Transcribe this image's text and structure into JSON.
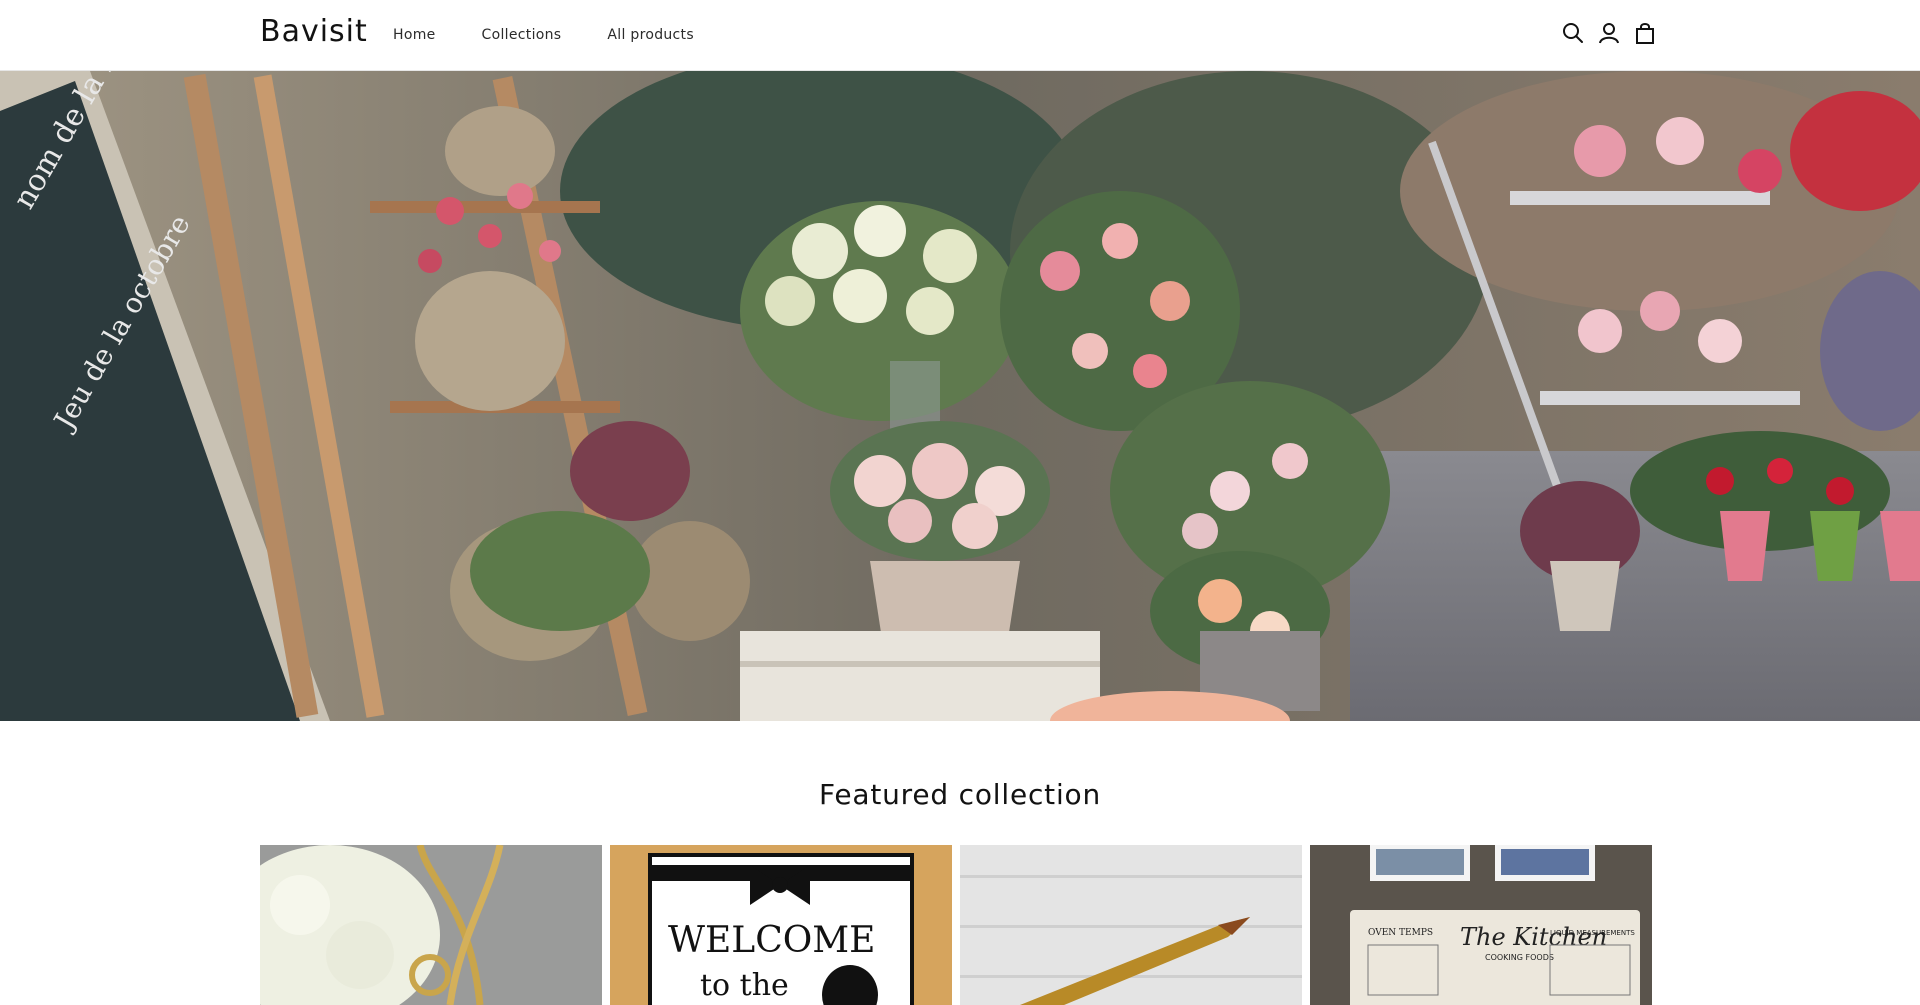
{
  "header": {
    "logo": "Bavisit",
    "nav": [
      {
        "label": "Home"
      },
      {
        "label": "Collections"
      },
      {
        "label": "All products"
      }
    ],
    "icons": [
      "search-icon",
      "account-icon",
      "cart-icon"
    ]
  },
  "hero": {
    "image": "flower-shop-storefront"
  },
  "featured": {
    "title": "Featured collection",
    "products": [
      {
        "image": "gold-chain-necklace-with-flowers"
      },
      {
        "image": "welcome-sign-with-bow",
        "sign_text_1": "WELCOME",
        "sign_text_2": "to the"
      },
      {
        "image": "gold-bullet-pen"
      },
      {
        "image": "kitchen-conversion-chart",
        "chart_title": "The Kitchen",
        "chart_subtitle": "COOKING FOODS",
        "left_header": "OVEN TEMPS",
        "right_header": "LIQUID MEASUREMENTS"
      }
    ]
  },
  "colors": {
    "text": "#121212",
    "background": "#ffffff",
    "border": "#e6e6e6"
  }
}
